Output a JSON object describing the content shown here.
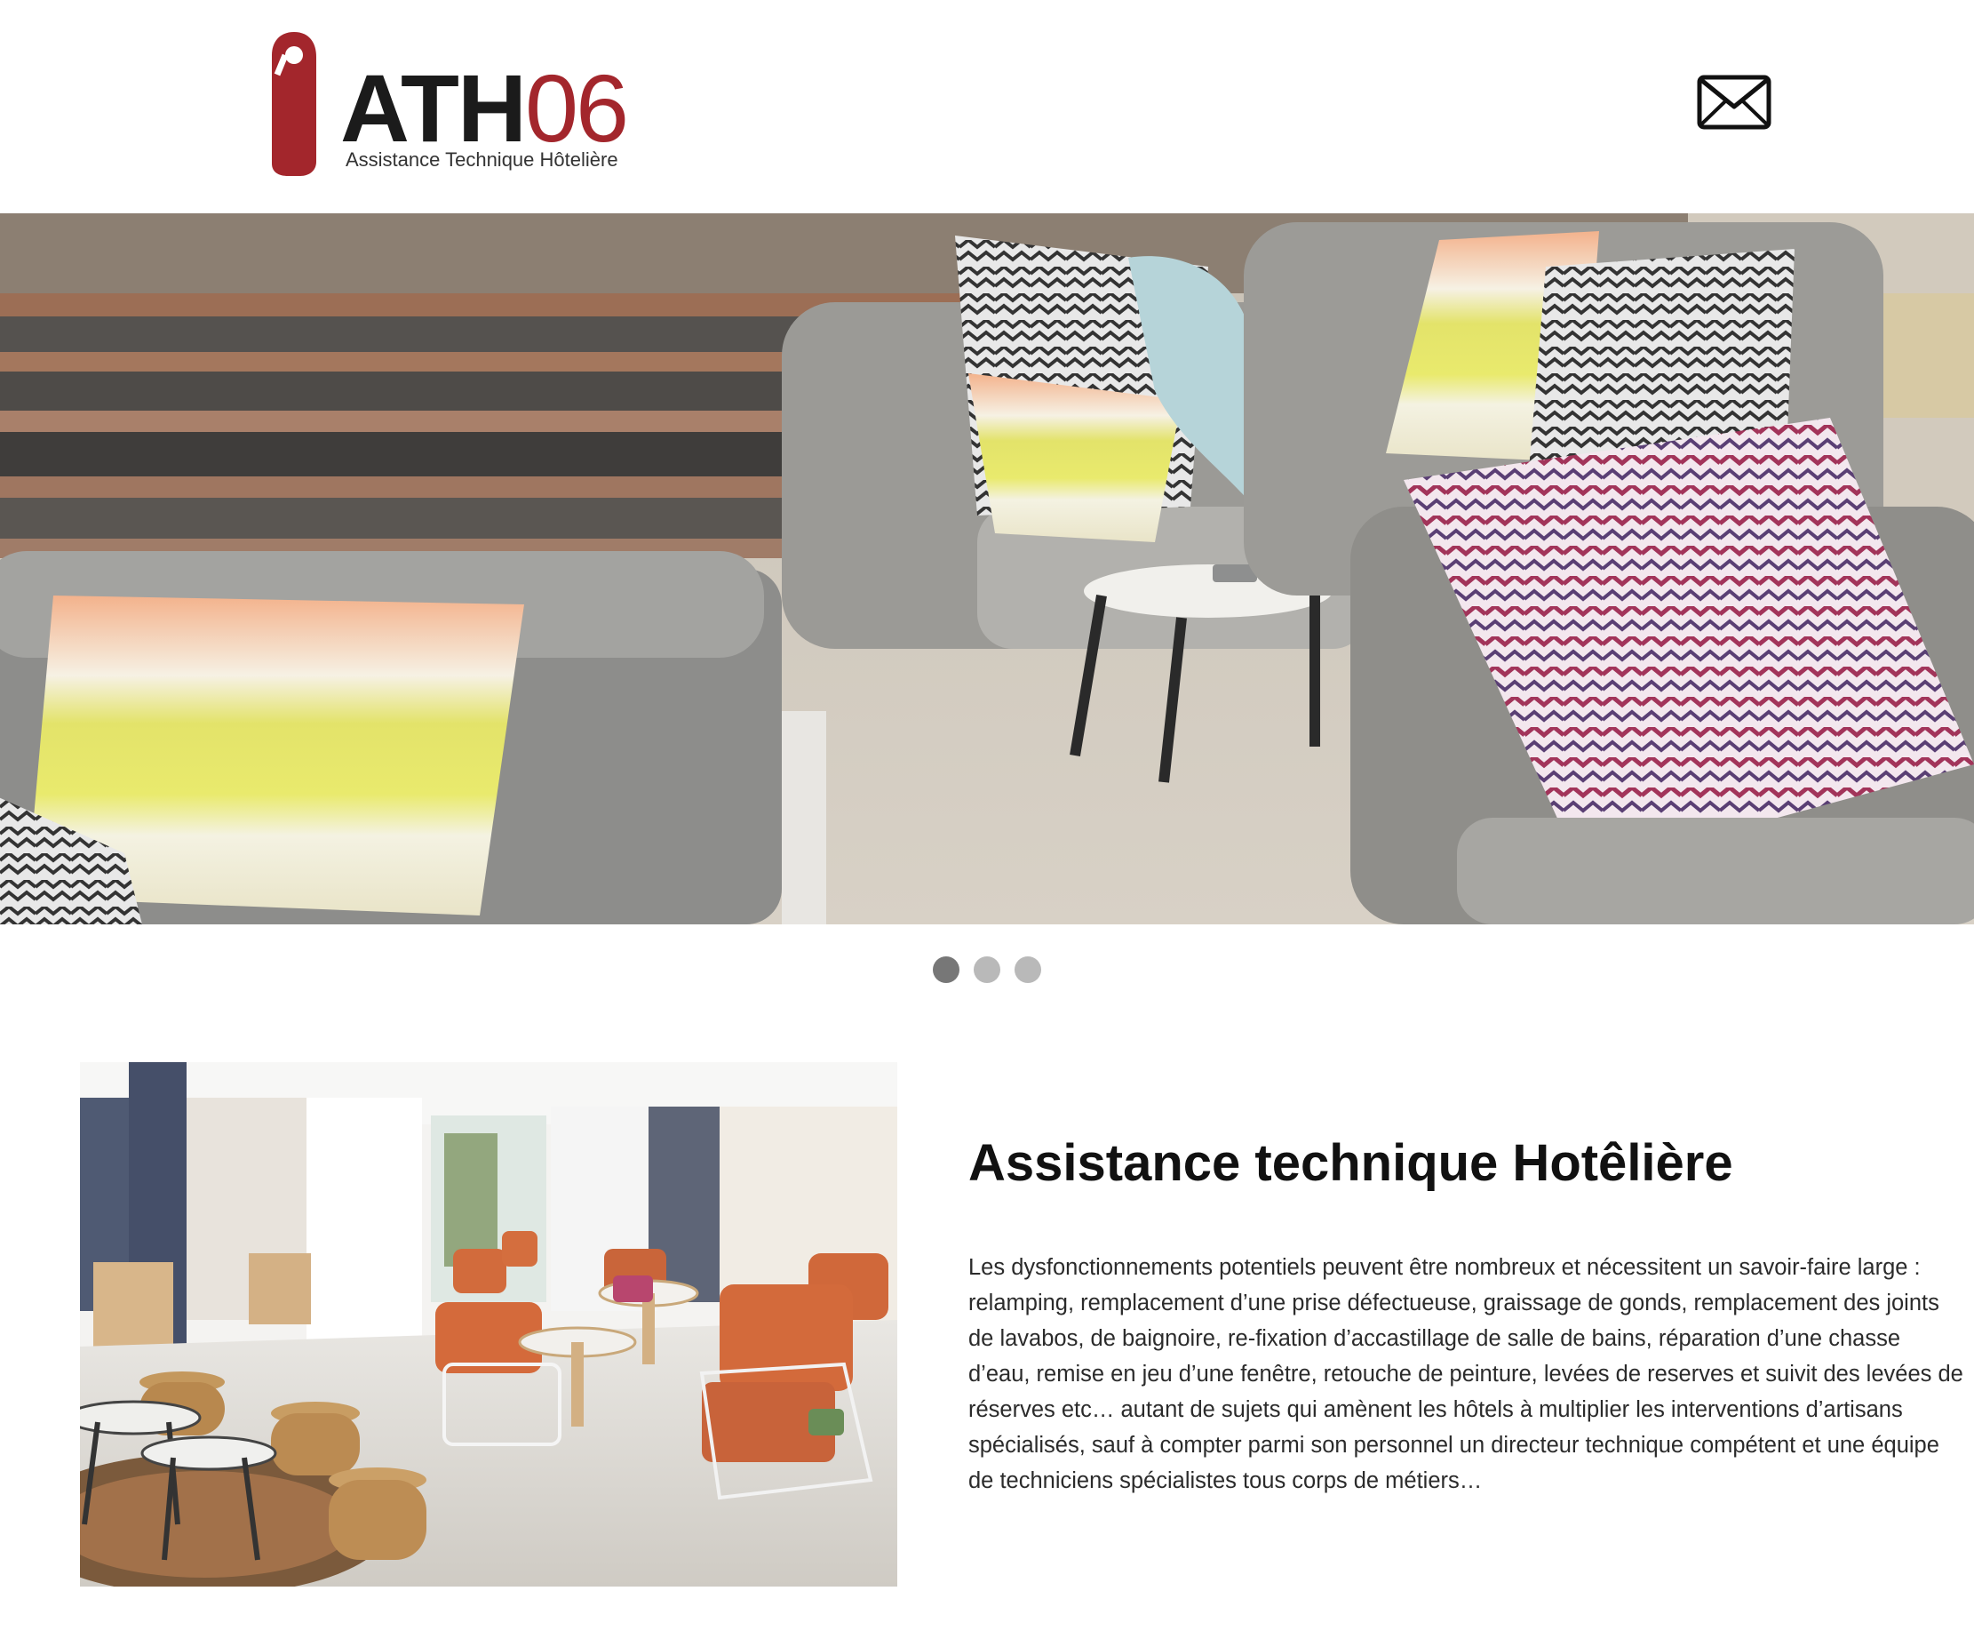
{
  "header": {
    "logo": {
      "brand_letters": "ATH",
      "brand_number": "06",
      "tagline": "Assistance Technique Hôtelière",
      "icon": "door-hanger-icon"
    },
    "contact_icon": "mail-icon"
  },
  "hero": {
    "image": "outdoor-beach-lounge-sofas-with-cushions",
    "slides": 3,
    "active_slide": 1
  },
  "feature": {
    "image": "hotel-lobby-with-orange-chairs",
    "title": "Assistance technique Hotêlière",
    "body": "Les dysfonctionnements potentiels peuvent être nombreux et nécessitent un savoir-faire large : relamping, remplacement d’une prise défectueuse, graissage de gonds, remplacement des joints de lavabos, de baignoire, re-fixation d’accastillage de salle de bains, réparation d’une chasse d’eau, remise en jeu d’une fenêtre, retouche de peinture, levées de reserves et suivit des levées de réserves etc… autant de sujets qui amènent les hôtels à multiplier les interventions d’artisans spécialisés, sauf à compter parmi son personnel un directeur technique compétent et une équipe de techniciens spécialistes tous corps de métiers…"
  },
  "colors": {
    "brand_red": "#a3262c",
    "brand_dark": "#1b1b1b",
    "dot_active": "#777777",
    "dot_inactive": "#b9b9b9"
  }
}
